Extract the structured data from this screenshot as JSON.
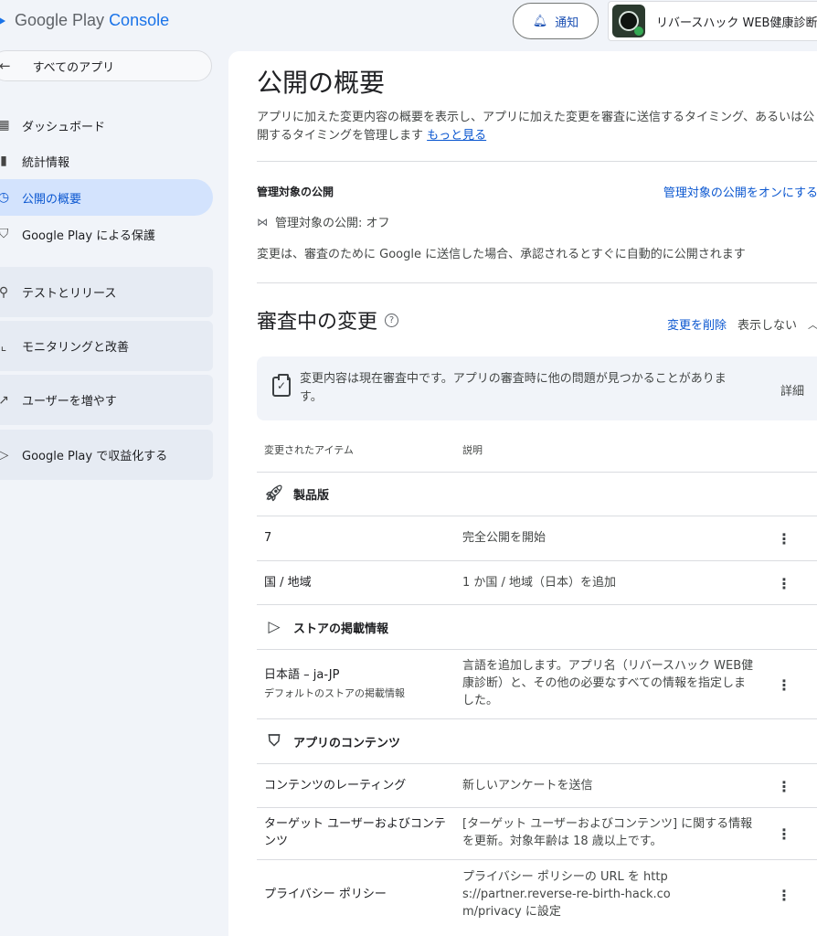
{
  "header": {
    "logo_brand": "Google Play",
    "logo_product": "Console",
    "notify_label": "通知",
    "app_name": "リバースハック WEB健康診断"
  },
  "sidebar": {
    "all_apps": "すべてのアプリ",
    "items": [
      {
        "label": "ダッシュボード",
        "icon": "dashboard-icon"
      },
      {
        "label": "統計情報",
        "icon": "bar-chart-icon"
      },
      {
        "label": "公開の概要",
        "icon": "publishing-icon",
        "active": true
      },
      {
        "label": "Google Play による保護",
        "icon": "shield-icon"
      }
    ],
    "groups": [
      {
        "label": "テストとリリース",
        "icon": "rocket-icon"
      },
      {
        "label": "モニタリングと改善",
        "icon": "trend-icon"
      },
      {
        "label": "ユーザーを増やす",
        "icon": "growth-icon"
      },
      {
        "label": "Google Play で収益化する",
        "icon": "play-icon"
      }
    ]
  },
  "main": {
    "title": "公開の概要",
    "description": "アプリに加えた変更内容の概要を表示し、アプリに加えた変更を審査に送信するタイミング、あるいは公開するタイミングを管理します ",
    "learn_more": "もっと見る",
    "managed": {
      "label": "管理対象の公開",
      "toggle_link": "管理対象の公開をオンにする",
      "status": "管理対象の公開: オフ",
      "note": "変更は、審査のために Google に送信した場合、承認されるとすぐに自動的に公開されます"
    },
    "review": {
      "title": "審査中の変更",
      "delete_label": "変更を削除",
      "hide_label": "表示しない",
      "banner_text": "変更内容は現在審査中です。アプリの審査時に他の問題が見つかることがあります。",
      "banner_detail": "詳細"
    },
    "table": {
      "headers": [
        "変更されたアイテム",
        "説明"
      ],
      "groups": {
        "production": "製品版",
        "store": "ストアの掲載情報",
        "content": "アプリのコンテンツ"
      },
      "rows": [
        {
          "item": "7",
          "desc": "完全公開を開始"
        },
        {
          "item": "国 / 地域",
          "desc": "1 か国 / 地域（日本）を追加"
        },
        {
          "item": "日本語 – ja-JP",
          "sub": "デフォルトのストアの掲載情報",
          "desc": "言語を追加します。アプリ名（リバースハック WEB健康診断）と、その他の必要なすべての情報を指定しました。"
        },
        {
          "item": "コンテンツのレーティング",
          "desc": "新しいアンケートを送信"
        },
        {
          "item": "ターゲット ユーザーおよびコンテンツ",
          "desc": "[ターゲット ユーザーおよびコンテンツ] に関する情報を更新。対象年齢は 18 歳以上です。"
        },
        {
          "item": "プライバシー ポリシー",
          "desc": "プライバシー ポリシーの URL を https://partner.reverse-re-birth-hack.com/privacy に設定"
        }
      ]
    }
  },
  "colors": {
    "accent": "#0b57d0",
    "active_bg": "#d3e3fd",
    "page_bg": "#f1f4f9"
  }
}
